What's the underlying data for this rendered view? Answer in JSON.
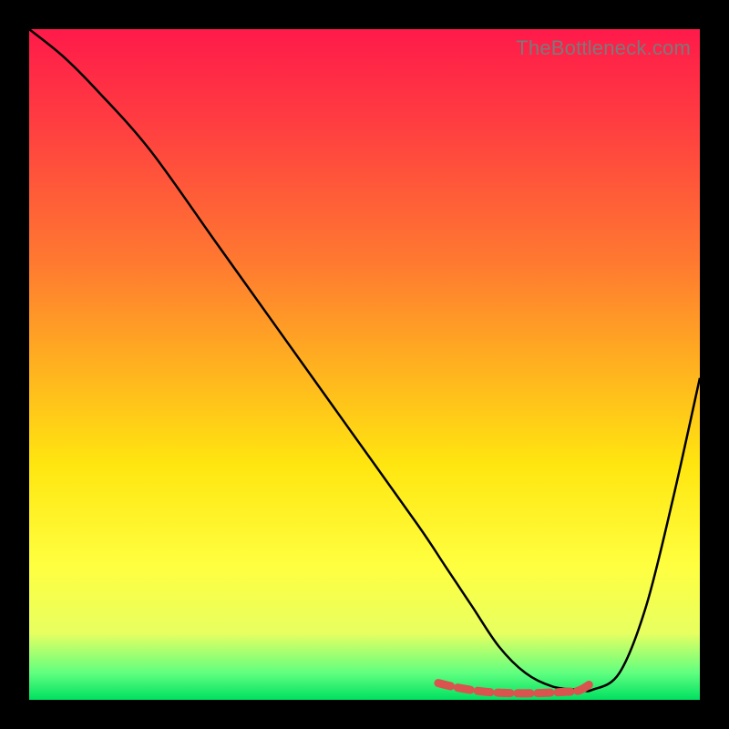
{
  "watermark": "TheBottleneck.com",
  "chart_data": {
    "type": "line",
    "title": "",
    "xlabel": "",
    "ylabel": "",
    "xlim": [
      0,
      100
    ],
    "ylim": [
      0,
      100
    ],
    "series": [
      {
        "name": "bottleneck-curve",
        "color": "#000000",
        "x": [
          0,
          5,
          10,
          18,
          28,
          38,
          48,
          58,
          62,
          66,
          70,
          74,
          78,
          82,
          84,
          88,
          92,
          96,
          100
        ],
        "y": [
          100,
          96,
          91,
          82,
          68,
          54,
          40,
          26,
          20,
          14,
          8,
          4,
          2,
          1.5,
          1.5,
          4,
          14,
          30,
          48
        ]
      },
      {
        "name": "highlight-band",
        "color": "#d9534f",
        "x": [
          61,
          64,
          68,
          72,
          76,
          80,
          82,
          84
        ],
        "y": [
          2.5,
          1.8,
          1.2,
          1.0,
          1.0,
          1.2,
          1.4,
          2.6
        ]
      }
    ],
    "background_gradient": {
      "top": "#ff1a4a",
      "bottom": "#00e060"
    }
  }
}
